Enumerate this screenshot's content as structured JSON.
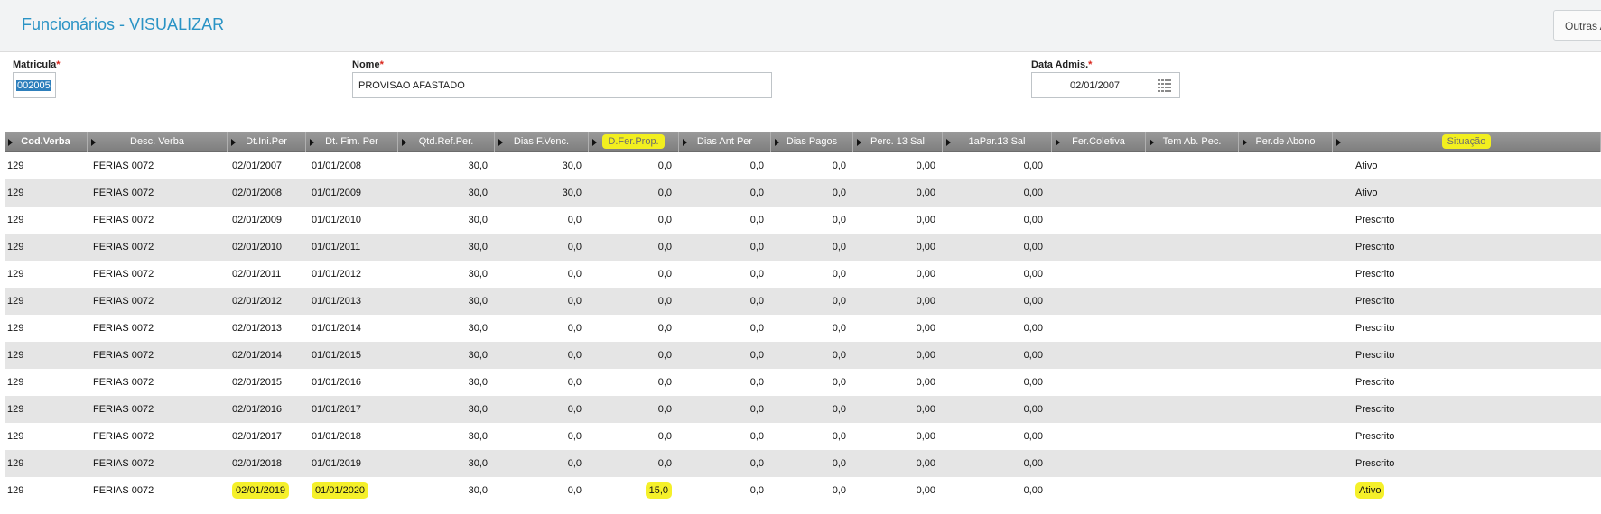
{
  "page": {
    "title": "Funcionários - VISUALIZAR",
    "outras_label": "Outras A"
  },
  "form": {
    "matricula_label": "Matricula",
    "matricula_value": "002005",
    "nome_label": "Nome",
    "nome_value": "PROVISAO AFASTADO",
    "data_label": "Data Admis.",
    "data_value": "02/01/2007",
    "required_mark": "*"
  },
  "grid": {
    "columns": [
      "Cod.Verba",
      "Desc. Verba",
      "Dt.Ini.Per",
      "Dt. Fim. Per",
      "Qtd.Ref.Per.",
      "Dias F.Venc.",
      "D.Fer.Prop.",
      "Dias Ant Per",
      "Dias Pagos",
      "Perc. 13 Sal",
      "1aPar.13 Sal",
      "Fer.Coletiva",
      "Tem Ab. Pec.",
      "Per.de Abono",
      "Situação"
    ],
    "highlighted_columns": [
      "D.Fer.Prop.",
      "Situação"
    ],
    "rows": [
      [
        "129",
        "FERIAS 0072",
        "02/01/2007",
        "01/01/2008",
        "30,0",
        "30,0",
        "0,0",
        "0,0",
        "0,0",
        "0,00",
        "0,00",
        "",
        "",
        "",
        "Ativo"
      ],
      [
        "129",
        "FERIAS 0072",
        "02/01/2008",
        "01/01/2009",
        "30,0",
        "30,0",
        "0,0",
        "0,0",
        "0,0",
        "0,00",
        "0,00",
        "",
        "",
        "",
        "Ativo"
      ],
      [
        "129",
        "FERIAS 0072",
        "02/01/2009",
        "01/01/2010",
        "30,0",
        "0,0",
        "0,0",
        "0,0",
        "0,0",
        "0,00",
        "0,00",
        "",
        "",
        "",
        "Prescrito"
      ],
      [
        "129",
        "FERIAS 0072",
        "02/01/2010",
        "01/01/2011",
        "30,0",
        "0,0",
        "0,0",
        "0,0",
        "0,0",
        "0,00",
        "0,00",
        "",
        "",
        "",
        "Prescrito"
      ],
      [
        "129",
        "FERIAS 0072",
        "02/01/2011",
        "01/01/2012",
        "30,0",
        "0,0",
        "0,0",
        "0,0",
        "0,0",
        "0,00",
        "0,00",
        "",
        "",
        "",
        "Prescrito"
      ],
      [
        "129",
        "FERIAS 0072",
        "02/01/2012",
        "01/01/2013",
        "30,0",
        "0,0",
        "0,0",
        "0,0",
        "0,0",
        "0,00",
        "0,00",
        "",
        "",
        "",
        "Prescrito"
      ],
      [
        "129",
        "FERIAS 0072",
        "02/01/2013",
        "01/01/2014",
        "30,0",
        "0,0",
        "0,0",
        "0,0",
        "0,0",
        "0,00",
        "0,00",
        "",
        "",
        "",
        "Prescrito"
      ],
      [
        "129",
        "FERIAS 0072",
        "02/01/2014",
        "01/01/2015",
        "30,0",
        "0,0",
        "0,0",
        "0,0",
        "0,0",
        "0,00",
        "0,00",
        "",
        "",
        "",
        "Prescrito"
      ],
      [
        "129",
        "FERIAS 0072",
        "02/01/2015",
        "01/01/2016",
        "30,0",
        "0,0",
        "0,0",
        "0,0",
        "0,0",
        "0,00",
        "0,00",
        "",
        "",
        "",
        "Prescrito"
      ],
      [
        "129",
        "FERIAS 0072",
        "02/01/2016",
        "01/01/2017",
        "30,0",
        "0,0",
        "0,0",
        "0,0",
        "0,0",
        "0,00",
        "0,00",
        "",
        "",
        "",
        "Prescrito"
      ],
      [
        "129",
        "FERIAS 0072",
        "02/01/2017",
        "01/01/2018",
        "30,0",
        "0,0",
        "0,0",
        "0,0",
        "0,0",
        "0,00",
        "0,00",
        "",
        "",
        "",
        "Prescrito"
      ],
      [
        "129",
        "FERIAS 0072",
        "02/01/2018",
        "01/01/2019",
        "30,0",
        "0,0",
        "0,0",
        "0,0",
        "0,0",
        "0,00",
        "0,00",
        "",
        "",
        "",
        "Prescrito"
      ],
      [
        "129",
        "FERIAS 0072",
        "02/01/2019",
        "01/01/2020",
        "30,0",
        "0,0",
        "15,0",
        "0,0",
        "0,0",
        "0,00",
        "0,00",
        "",
        "",
        "",
        "Ativo"
      ]
    ],
    "highlighted_row_fields": {
      "row": 12,
      "columns": [
        2,
        3,
        6,
        14
      ]
    }
  },
  "colors": {
    "title": "#2a93c5",
    "header": "#8c8c8c",
    "highlight": "#f5f02a"
  },
  "icons": {
    "calendar": "calendar-icon",
    "sort": "sort-arrow-icon"
  }
}
